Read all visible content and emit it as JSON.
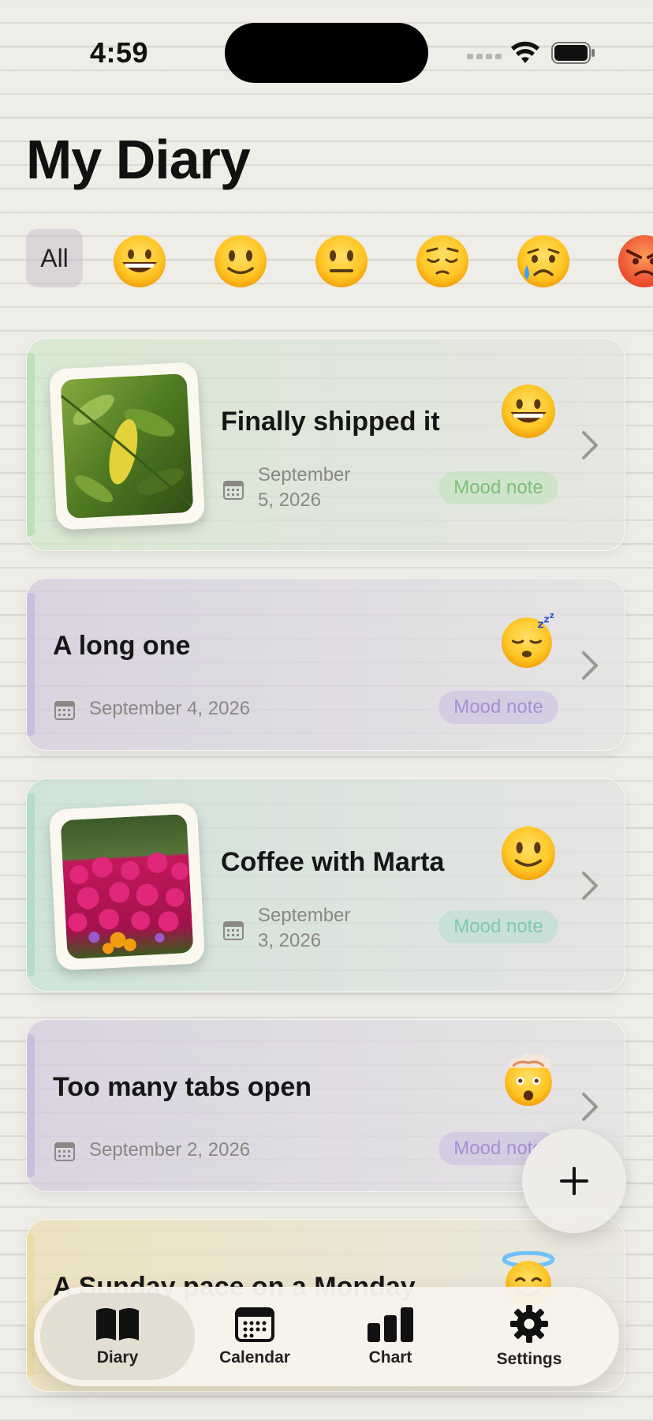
{
  "status_bar": {
    "time": "4:59"
  },
  "header": {
    "title": "My Diary"
  },
  "filters": {
    "all_label": "All",
    "moods": [
      {
        "icon": "grinning-face-icon"
      },
      {
        "icon": "slightly-smiling-face-icon"
      },
      {
        "icon": "neutral-face-icon"
      },
      {
        "icon": "pensive-face-icon"
      },
      {
        "icon": "crying-face-icon"
      },
      {
        "icon": "angry-face-icon"
      }
    ]
  },
  "entries": [
    {
      "title": "Finally shipped it",
      "date": "September 5, 2026",
      "date_line1": "September",
      "date_line2": "5, 2026",
      "badge": "Mood note",
      "mood_icon": "grinning-face-icon",
      "photo": "leaf-photo",
      "accent": "#bde0b8"
    },
    {
      "title": "A long one",
      "date": "September 4, 2026",
      "badge": "Mood note",
      "mood_icon": "sleeping-face-icon",
      "accent": "#c9bfdc"
    },
    {
      "title": "Coffee with Marta",
      "date": "September 3, 2026",
      "date_line1": "September",
      "date_line2": "3, 2026",
      "badge": "Mood note",
      "mood_icon": "slightly-smiling-face-icon",
      "photo": "flowers-photo",
      "accent": "#b3dccd"
    },
    {
      "title": "Too many tabs open",
      "date": "September 2, 2026",
      "badge": "Mood note",
      "mood_icon": "exploding-head-icon",
      "accent": "#c9bfdc"
    },
    {
      "title": "A Sunday pace on a Monday",
      "mood_icon": "smiling-face-with-halo-icon",
      "accent": "#ecdca8"
    }
  ],
  "fab": {
    "icon": "plus-icon"
  },
  "tab_bar": {
    "tabs": [
      {
        "label": "Diary",
        "icon": "book-icon",
        "active": true
      },
      {
        "label": "Calendar",
        "icon": "calendar-icon"
      },
      {
        "label": "Chart",
        "icon": "bar-chart-icon"
      },
      {
        "label": "Settings",
        "icon": "gear-icon"
      }
    ]
  }
}
